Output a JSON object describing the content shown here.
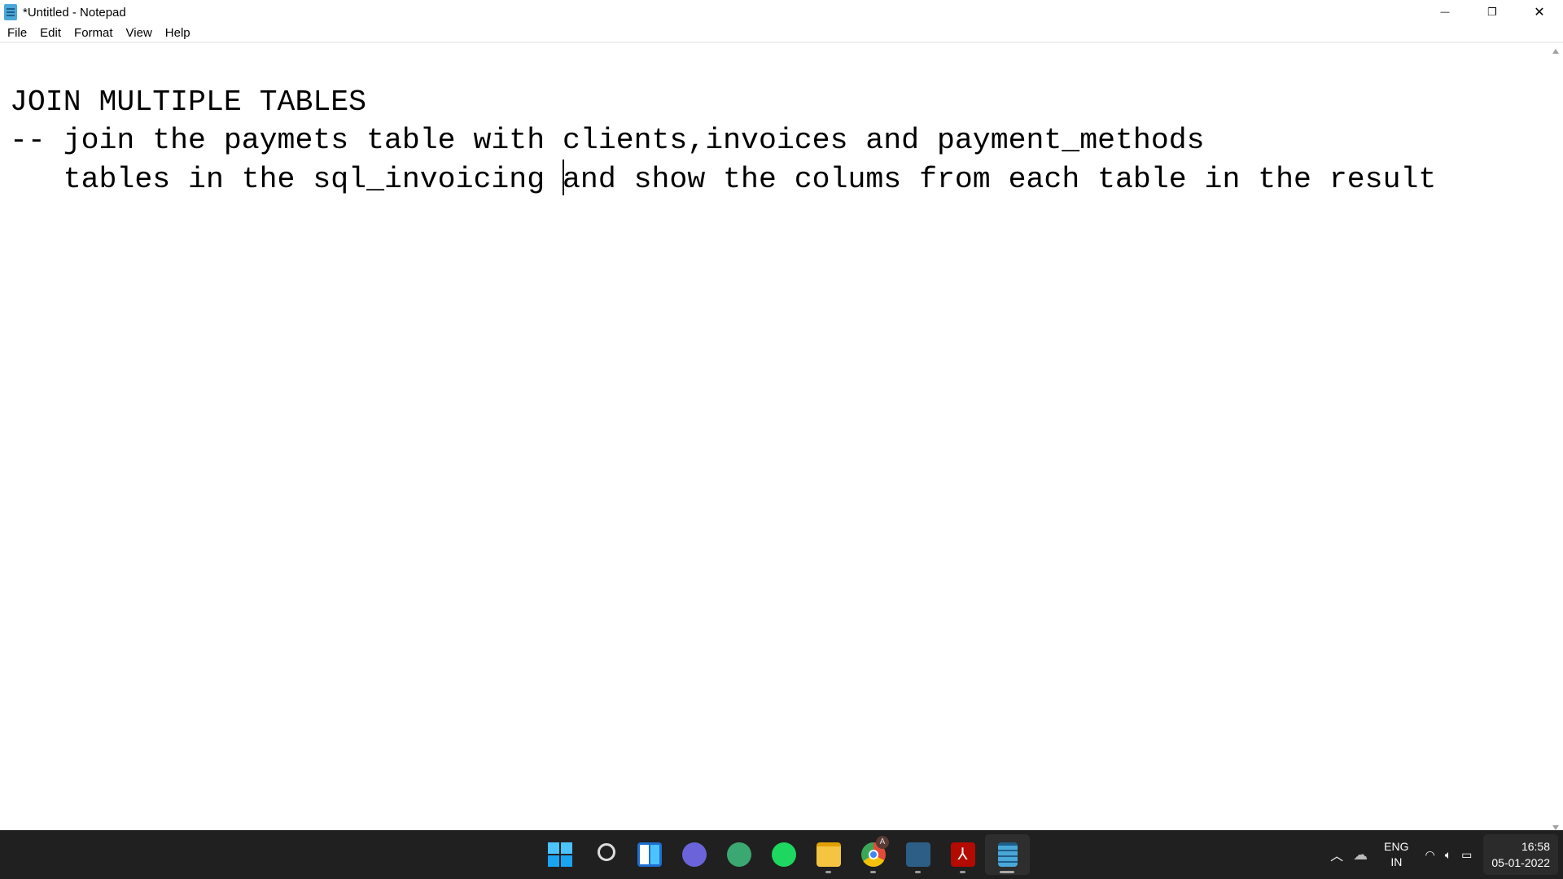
{
  "window": {
    "title": "*Untitled - Notepad",
    "minimize": "—",
    "restore": "❐",
    "close": "✕"
  },
  "menu": [
    "File",
    "Edit",
    "Format",
    "View",
    "Help"
  ],
  "editor": {
    "line1": "JOIN MULTIPLE TABLES",
    "line2": "-- join the paymets table with clients,invoices and payment_methods",
    "line3_before_caret": "   tables in the sql_invoicing ",
    "line3_after_caret": "and show the colums from each table in the result"
  },
  "taskbar": {
    "apps": [
      {
        "name": "start",
        "color": "#29a8ef"
      },
      {
        "name": "search",
        "color": "#ddd"
      },
      {
        "name": "widgets",
        "color": "#1d6fd1"
      },
      {
        "name": "teams-chat",
        "color": "#6b63d9"
      },
      {
        "name": "atom",
        "color": "#3aa870"
      },
      {
        "name": "spotify",
        "color": "#1ed760"
      },
      {
        "name": "file-explorer",
        "color": "#f5c542"
      },
      {
        "name": "chrome",
        "color": "#e04b3a"
      },
      {
        "name": "mysql-workbench",
        "color": "#2c5e86"
      },
      {
        "name": "acrobat",
        "color": "#b30b00"
      },
      {
        "name": "notepad",
        "color": "#4aa8d8"
      }
    ],
    "chrome_badge": "A",
    "tray": {
      "lang": "ENG",
      "region": "IN",
      "time": "16:58",
      "date": "05-01-2022"
    }
  }
}
